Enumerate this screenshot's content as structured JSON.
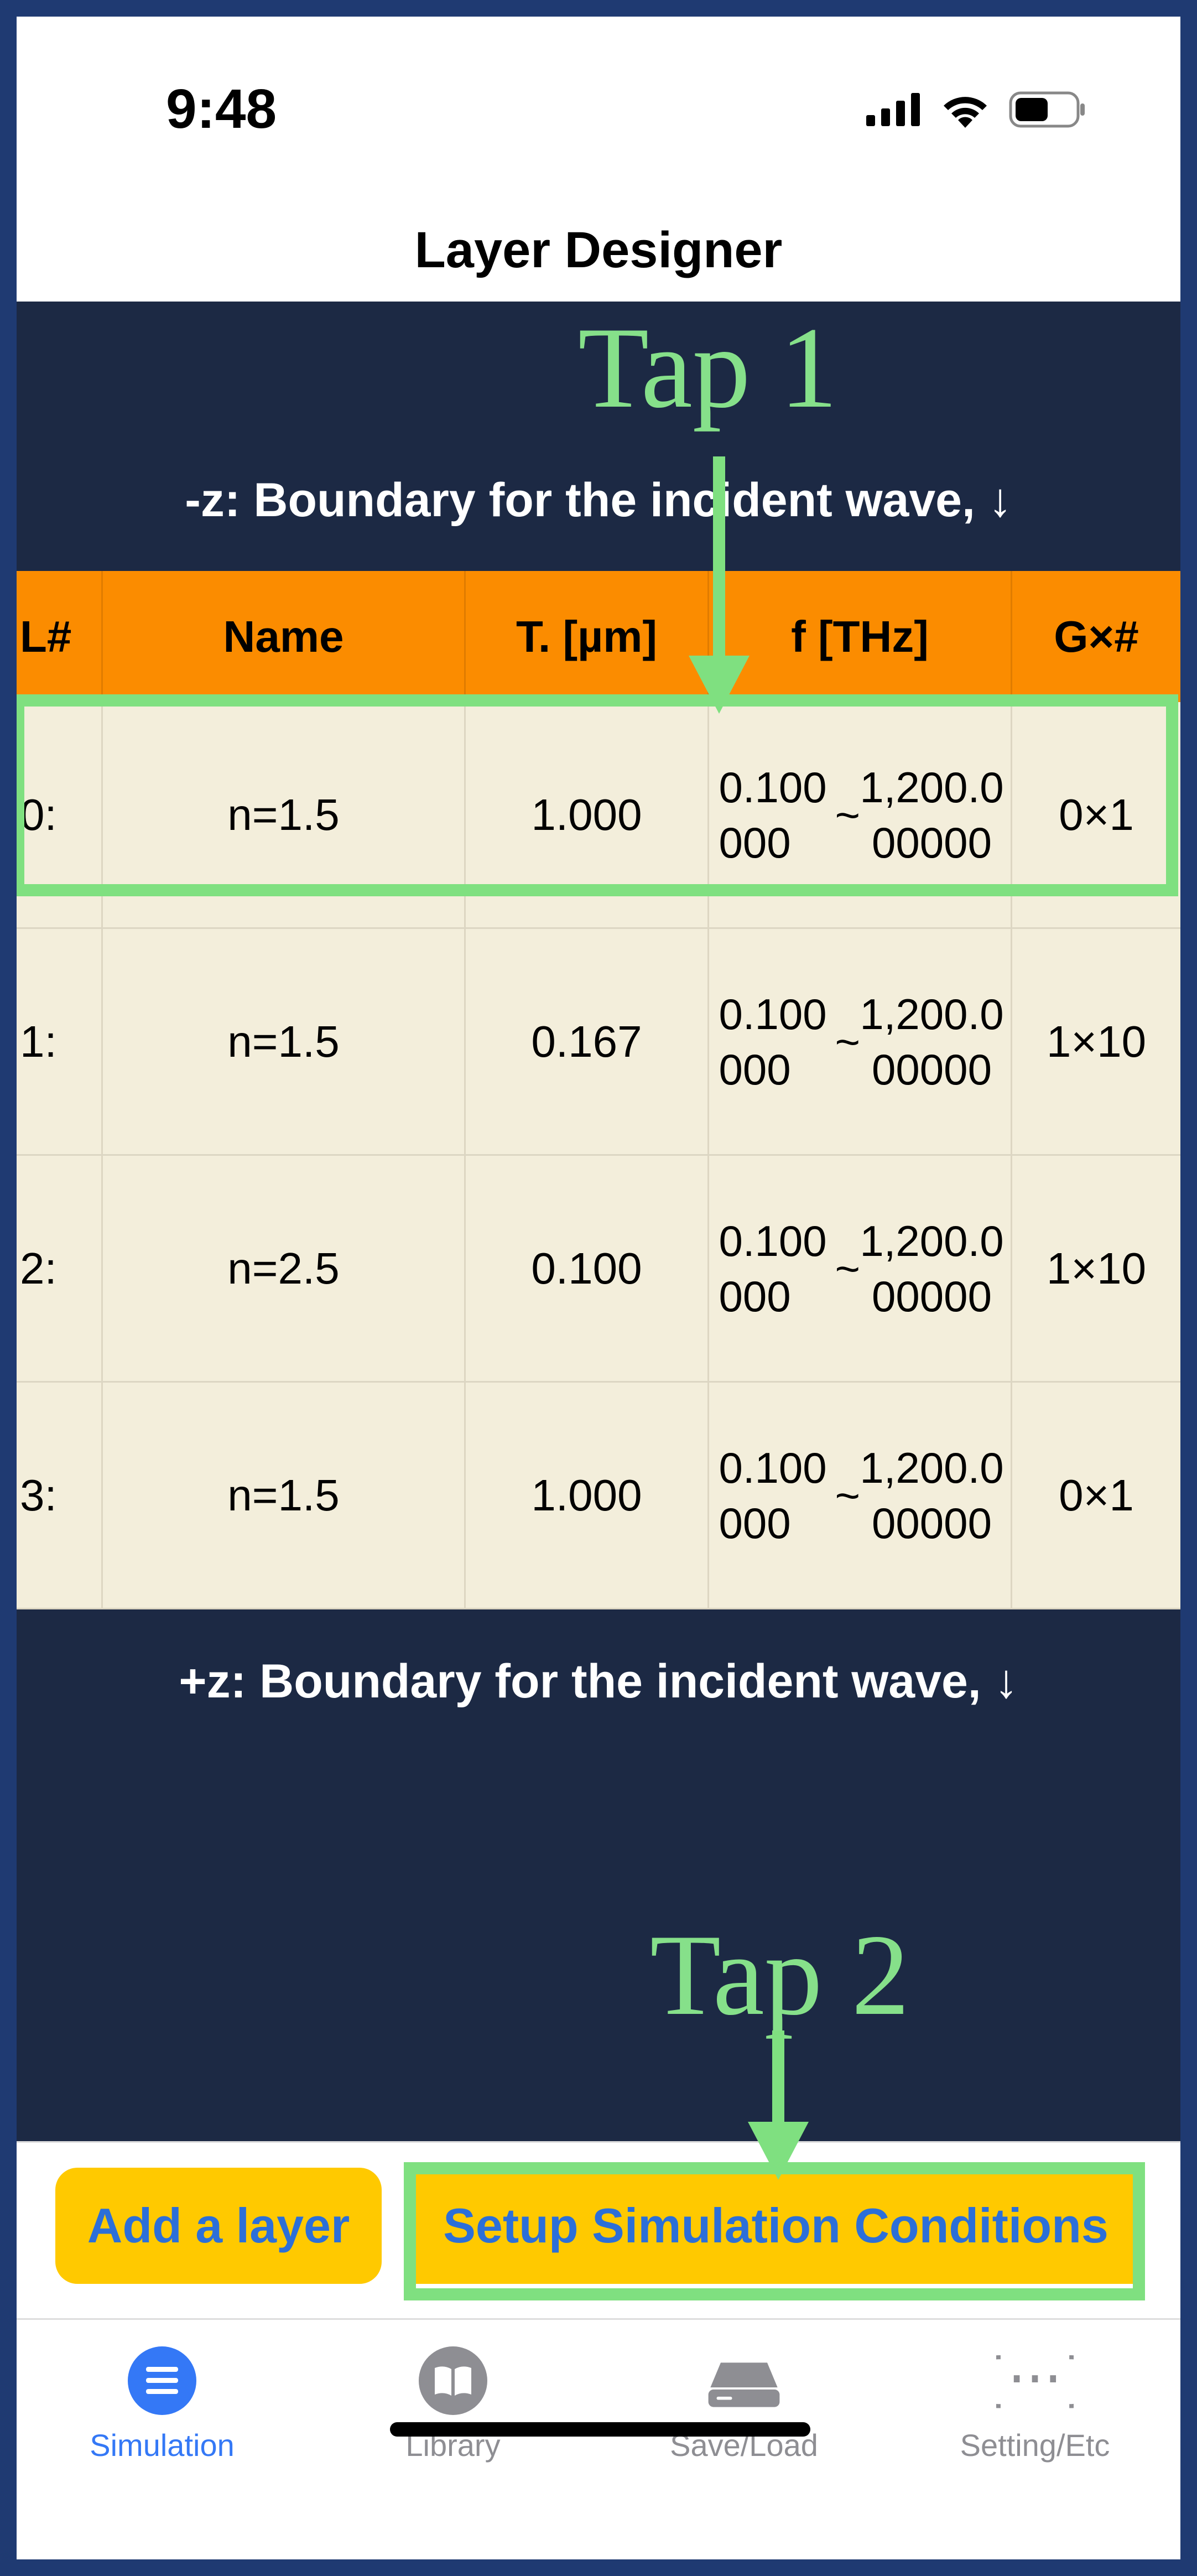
{
  "status_bar": {
    "time": "9:48"
  },
  "nav": {
    "title": "Layer Designer"
  },
  "boundaries": {
    "top": "-z: Boundary for the incident wave, ↓",
    "bottom": "+z: Boundary for the incident wave, ↓"
  },
  "table": {
    "headers": {
      "index": "L#",
      "name": "Name",
      "thickness": "T. [µm]",
      "frequency": "f [THz]",
      "grid": "G×#"
    },
    "rows": [
      {
        "index": "0:",
        "name": "n=1.5",
        "thickness": "1.000",
        "freq_min": "0.100000",
        "tilde": "~",
        "freq_max": "1,200.000000",
        "grid": "0×1"
      },
      {
        "index": "1:",
        "name": "n=1.5",
        "thickness": "0.167",
        "freq_min": "0.100000",
        "tilde": "~",
        "freq_max": "1,200.000000",
        "grid": "1×10"
      },
      {
        "index": "2:",
        "name": "n=2.5",
        "thickness": "0.100",
        "freq_min": "0.100000",
        "tilde": "~",
        "freq_max": "1,200.000000",
        "grid": "1×10"
      },
      {
        "index": "3:",
        "name": "n=1.5",
        "thickness": "1.000",
        "freq_min": "0.100000",
        "tilde": "~",
        "freq_max": "1,200.000000",
        "grid": "0×1"
      }
    ]
  },
  "toolbar": {
    "add_layer": "Add a layer",
    "setup": "Setup Simulation Conditions"
  },
  "tabs": [
    {
      "label": "Simulation",
      "icon": "list-icon",
      "active": true
    },
    {
      "label": "Library",
      "icon": "book-icon",
      "active": false
    },
    {
      "label": "Save/Load",
      "icon": "drive-icon",
      "active": false
    },
    {
      "label": "Setting/Etc",
      "icon": "braces-icon",
      "active": false
    }
  ],
  "annotations": {
    "tap1": "Tap 1",
    "tap2": "Tap 2"
  },
  "colors": {
    "header_bg": "#fb8c00",
    "row_bg": "#f3eedb",
    "content_bg": "#1c2944",
    "button_bg": "#ffc900",
    "button_text": "#2c6fd8",
    "annotation": "#7fe080",
    "tab_active": "#3478f6"
  }
}
